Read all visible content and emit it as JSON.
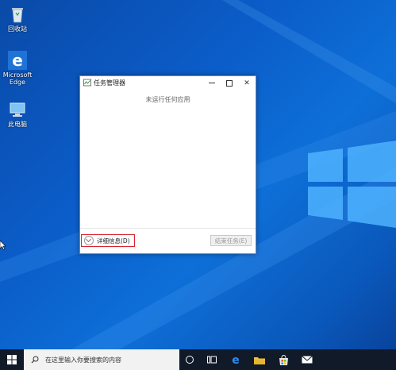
{
  "desktop": {
    "icons": [
      {
        "label": "回收站",
        "icon": "recycle-bin-icon"
      },
      {
        "label": "Microsoft Edge",
        "icon": "edge-icon"
      },
      {
        "label": "此电脑",
        "icon": "computer-icon"
      }
    ]
  },
  "task_manager": {
    "title": "任务管理器",
    "empty_message": "未运行任何应用",
    "details_label": "详细信息(D)",
    "end_task_label": "结束任务(E)",
    "controls": [
      "minimize",
      "maximize",
      "close"
    ]
  },
  "taskbar": {
    "search_placeholder": "在这里输入你要搜索的内容",
    "items": [
      "start-icon",
      "search-icon",
      "cortana-icon",
      "task-view-icon",
      "edge-icon",
      "file-explorer-icon",
      "store-icon",
      "mail-icon"
    ]
  },
  "colors": {
    "desktop_blue": "#0b5cc8",
    "highlight_red": "#d9232d",
    "taskbar": "#101a28"
  }
}
